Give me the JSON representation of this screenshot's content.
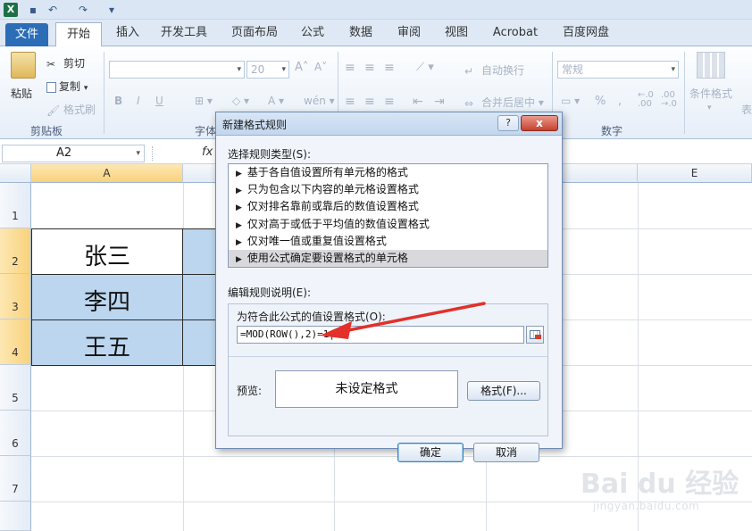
{
  "ribbon_tabs": [
    "文件",
    "开始",
    "插入",
    "开发工具",
    "页面布局",
    "公式",
    "数据",
    "审阅",
    "视图",
    "Acrobat",
    "百度网盘"
  ],
  "active_tab": "开始",
  "ribbon": {
    "paste": "粘贴",
    "cut": "剪切",
    "copy": "复制",
    "format_painter": "格式刷",
    "clipboard_group": "剪贴板",
    "font_size": "20",
    "font_group": "字体",
    "wrap_text": "自动换行",
    "merge_center": "合并后居中",
    "number_format": "常规",
    "number_group": "数字",
    "cond_format": "条件格式",
    "next_cut": "表",
    "bold": "B",
    "italic": "I",
    "underline": "U"
  },
  "formula_bar": {
    "name_box": "A2",
    "fx": "fx"
  },
  "grid": {
    "columns": [
      "A",
      "E"
    ],
    "rows": [
      "1",
      "2",
      "3",
      "4",
      "5",
      "6",
      "7"
    ],
    "cells": [
      "张三",
      "李四",
      "王五"
    ]
  },
  "dialog": {
    "title": "新建格式规则",
    "help": "?",
    "close": "x",
    "select_rule_type_label": "选择规则类型(S):",
    "rule_types": [
      "基于各自值设置所有单元格的格式",
      "只为包含以下内容的单元格设置格式",
      "仅对排名靠前或靠后的数值设置格式",
      "仅对高于或低于平均值的数值设置格式",
      "仅对唯一值或重复值设置格式",
      "使用公式确定要设置格式的单元格"
    ],
    "selected_rule_index": 5,
    "edit_desc_label": "编辑规则说明(E):",
    "formula_label": "为符合此公式的值设置格式(O):",
    "formula_value": "=MOD(ROW(),2)=1|",
    "preview_label": "预览:",
    "preview_text": "未设定格式",
    "format_button": "格式(F)...",
    "ok_button": "确定",
    "cancel_button": "取消"
  },
  "watermark": {
    "brand": "Bai du 经验",
    "sub": "jingyan.baidu.com"
  },
  "colors": {
    "selection_fill": "#bcd6ef",
    "arrow": "#e3302b",
    "file_tab": "#2b6db6"
  }
}
